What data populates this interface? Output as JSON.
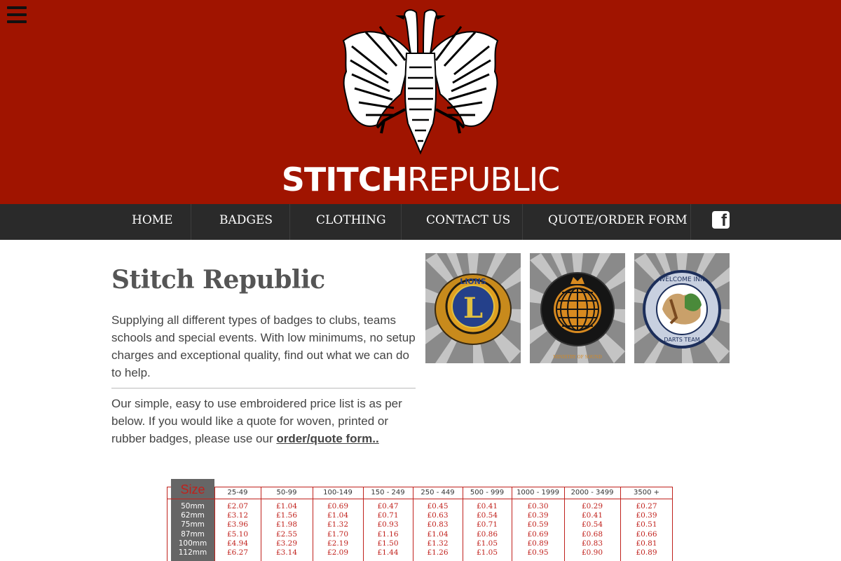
{
  "header": {
    "brand_bold": "STITCH",
    "brand_light": "REPUBLIC",
    "menu_icon": "hamburger-menu-icon",
    "logo_icon": "double-headed-eagle-icon"
  },
  "nav": {
    "items": [
      "HOME",
      "BADGES",
      "CLOTHING",
      "CONTACT US",
      "QUOTE/ORDER FORM"
    ],
    "social_icon": "facebook-icon"
  },
  "main": {
    "title": "Stitch Republic",
    "intro": "Supplying all different types of badges to clubs, teams schools and special events. With low minimums, no setup charges and exceptional quality, find out what we can do to help.",
    "pricing_text": "Our simple, easy to use embroidered price list is as per below. If you would like a quote for woven, printed or rubber badges, please use our ",
    "pricing_link": "order/quote form..",
    "badges": [
      {
        "icon": "lions-club-badge",
        "text": "LIONS",
        "letter": "L"
      },
      {
        "icon": "ministry-of-sound-badge",
        "text": "MINISTRY OF SOUND"
      },
      {
        "icon": "welcome-inn-darts-team-badge",
        "text_top": "WELCOME INN",
        "text_bottom": "DARTS TEAM"
      }
    ]
  },
  "price_table": {
    "size_header": "Size",
    "quantity_headers": [
      "25-49",
      "50-99",
      "100-149",
      "150 - 249",
      "250 - 449",
      "500 - 999",
      "1000 - 1999",
      "2000 - 3499",
      "3500 +"
    ],
    "rows": [
      {
        "size": "50mm",
        "prices": [
          "£2.07",
          "£1.04",
          "£0.69",
          "£0.47",
          "£0.45",
          "£0.41",
          "£0.30",
          "£0.29",
          "£0.27"
        ]
      },
      {
        "size": "62mm",
        "prices": [
          "£3.12",
          "£1.56",
          "£1.04",
          "£0.71",
          "£0.63",
          "£0.54",
          "£0.39",
          "£0.41",
          "£0.39"
        ]
      },
      {
        "size": "75mm",
        "prices": [
          "£3.96",
          "£1.98",
          "£1.32",
          "£0.93",
          "£0.83",
          "£0.71",
          "£0.59",
          "£0.54",
          "£0.51"
        ]
      },
      {
        "size": "87mm",
        "prices": [
          "£5.10",
          "£2.55",
          "£1.70",
          "£1.16",
          "£1.04",
          "£0.86",
          "£0.69",
          "£0.68",
          "£0.66"
        ]
      },
      {
        "size": "100mm",
        "prices": [
          "£4.94",
          "£3.29",
          "£2.19",
          "£1.50",
          "£1.32",
          "£1.05",
          "£0.89",
          "£0.83",
          "£0.81"
        ]
      },
      {
        "size": "112mm",
        "prices": [
          "£6.27",
          "£3.14",
          "£2.09",
          "£1.44",
          "£1.26",
          "£1.05",
          "£0.95",
          "£0.90",
          "£0.89"
        ]
      }
    ]
  },
  "colors": {
    "header_red": "#a01400",
    "nav_dark": "#2a2a2a",
    "table_red": "#c0211c",
    "size_column_grey": "#666666"
  }
}
